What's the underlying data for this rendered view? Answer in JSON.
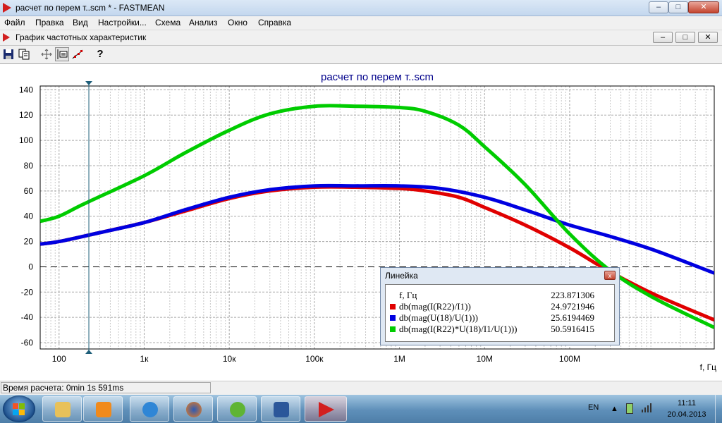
{
  "window": {
    "title": "расчет по перем т..scm * - FASTMEAN",
    "min_label": "–",
    "max_label": "□",
    "close_label": "✕"
  },
  "menu": [
    "Файл",
    "Правка",
    "Вид",
    "Настройки...",
    "Схема",
    "Анализ",
    "Окно",
    "Справка"
  ],
  "child_window": {
    "title": "График частотных характеристик"
  },
  "toolbar": {
    "help_label": "?"
  },
  "status": {
    "text": "Время расчета: 0min 1s 591ms"
  },
  "taskbar": {
    "lang": "EN",
    "time": "11:11",
    "date": "20.04.2013"
  },
  "ruler": {
    "title": "Линейка",
    "close_label": "x",
    "rows": [
      {
        "name": "f, Гц",
        "value": "223.871306",
        "color": ""
      },
      {
        "name": "db(mag(I(R22)/I1))",
        "value": "24.9721946",
        "color": "#e00000"
      },
      {
        "name": "db(mag(U(18)/U(1)))",
        "value": "25.6194469",
        "color": "#0000e0"
      },
      {
        "name": "db(mag(I(R22)*U(18)/I1/U(1)))",
        "value": "50.5916415",
        "color": "#00cc00"
      }
    ]
  },
  "chart_data": {
    "type": "line",
    "title": "расчет по перем т..scm",
    "xlabel": "f, Гц",
    "ylabel": "",
    "x_scale": "log",
    "xlim": [
      60,
      5000000000
    ],
    "ylim": [
      -65,
      143
    ],
    "x_tick_values": [
      100,
      1000,
      10000,
      100000,
      1000000,
      10000000,
      100000000
    ],
    "x_tick_labels": [
      "100",
      "1к",
      "10к",
      "100к",
      "1M",
      "10M",
      "100M"
    ],
    "y_ticks": [
      140,
      120,
      100,
      80,
      60,
      40,
      20,
      0,
      -20,
      -40,
      -60
    ],
    "grid": true,
    "cursor_x": 223.871306,
    "series": [
      {
        "name": "db(mag(I(R22)/I1))",
        "color": "#e00000",
        "x": [
          60,
          100,
          300,
          1000,
          3000,
          10000,
          30000,
          100000,
          300000,
          1000000,
          2000000,
          5000000,
          10000000,
          30000000,
          100000000,
          300000000,
          1000000000,
          5000000000
        ],
        "y": [
          18,
          20,
          27,
          35,
          44,
          54,
          60,
          63,
          63,
          62,
          60,
          55,
          47,
          33,
          15,
          -4,
          -22,
          -42
        ]
      },
      {
        "name": "db(mag(U(18)/U(1)))",
        "color": "#0000e0",
        "x": [
          60,
          100,
          300,
          1000,
          3000,
          10000,
          30000,
          100000,
          300000,
          1000000,
          3000000,
          10000000,
          30000000,
          100000000,
          300000000,
          1000000000,
          5000000000
        ],
        "y": [
          18,
          20,
          27,
          35,
          45,
          55,
          61,
          64,
          64,
          64,
          62,
          55,
          45,
          33,
          24,
          13,
          -5
        ]
      },
      {
        "name": "db(mag(I(R22)*U(18)/I1/U(1)))",
        "color": "#00cc00",
        "x": [
          60,
          100,
          200,
          1000,
          3000,
          10000,
          30000,
          100000,
          300000,
          1000000,
          2000000,
          5000000,
          10000000,
          30000000,
          100000000,
          300000000,
          1000000000,
          5000000000
        ],
        "y": [
          36,
          40,
          50,
          72,
          90,
          108,
          121,
          127,
          127,
          126,
          123,
          112,
          95,
          65,
          26,
          -3,
          -25,
          -48
        ]
      }
    ]
  }
}
